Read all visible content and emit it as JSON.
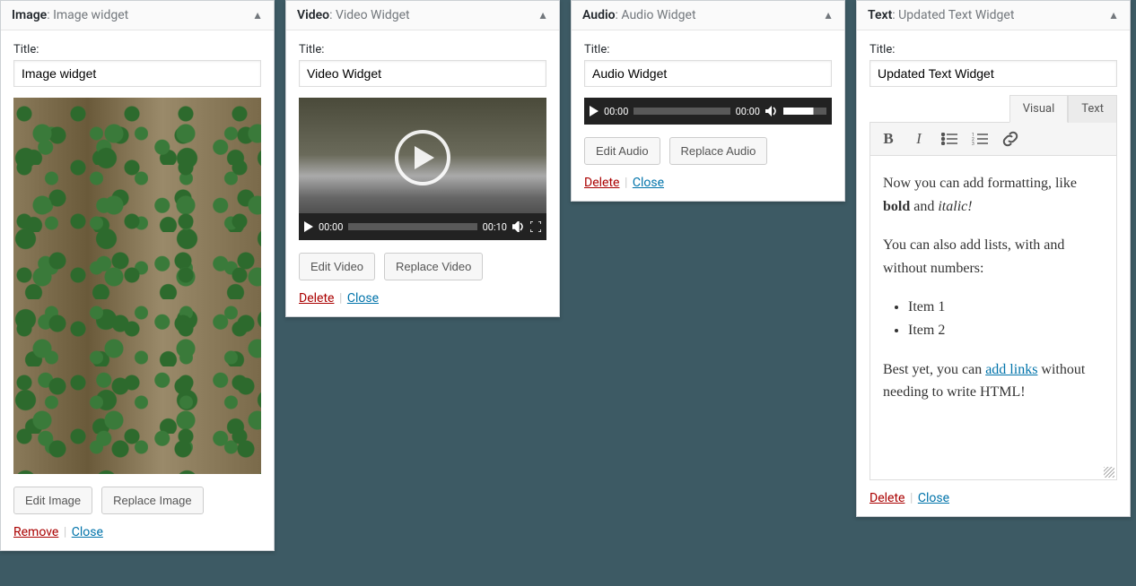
{
  "image_widget": {
    "type": "Image",
    "name": "Image widget",
    "title_label": "Title:",
    "title_value": "Image widget",
    "edit_btn": "Edit Image",
    "replace_btn": "Replace Image",
    "remove": "Remove",
    "close": "Close"
  },
  "video_widget": {
    "type": "Video",
    "name": "Video Widget",
    "title_label": "Title:",
    "title_value": "Video Widget",
    "time_current": "00:00",
    "time_total": "00:10",
    "edit_btn": "Edit Video",
    "replace_btn": "Replace Video",
    "delete": "Delete",
    "close": "Close"
  },
  "audio_widget": {
    "type": "Audio",
    "name": "Audio Widget",
    "title_label": "Title:",
    "title_value": "Audio Widget",
    "time_current": "00:00",
    "time_total": "00:00",
    "edit_btn": "Edit Audio",
    "replace_btn": "Replace Audio",
    "delete": "Delete",
    "close": "Close"
  },
  "text_widget": {
    "type": "Text",
    "name": "Updated Text Widget",
    "title_label": "Title:",
    "title_value": "Updated Text Widget",
    "tab_visual": "Visual",
    "tab_text": "Text",
    "content": {
      "p1_before": "Now you can add formatting, like ",
      "bold": "bold",
      "p1_mid": " and ",
      "italic": "italic!",
      "p2": "You can also add lists, with and without numbers:",
      "items": [
        "Item 1",
        "Item 2"
      ],
      "p3_before": "Best yet, you can ",
      "link": "add links",
      "p3_after": " without needing to write HTML!"
    },
    "delete": "Delete",
    "close": "Close"
  },
  "sep": "|"
}
